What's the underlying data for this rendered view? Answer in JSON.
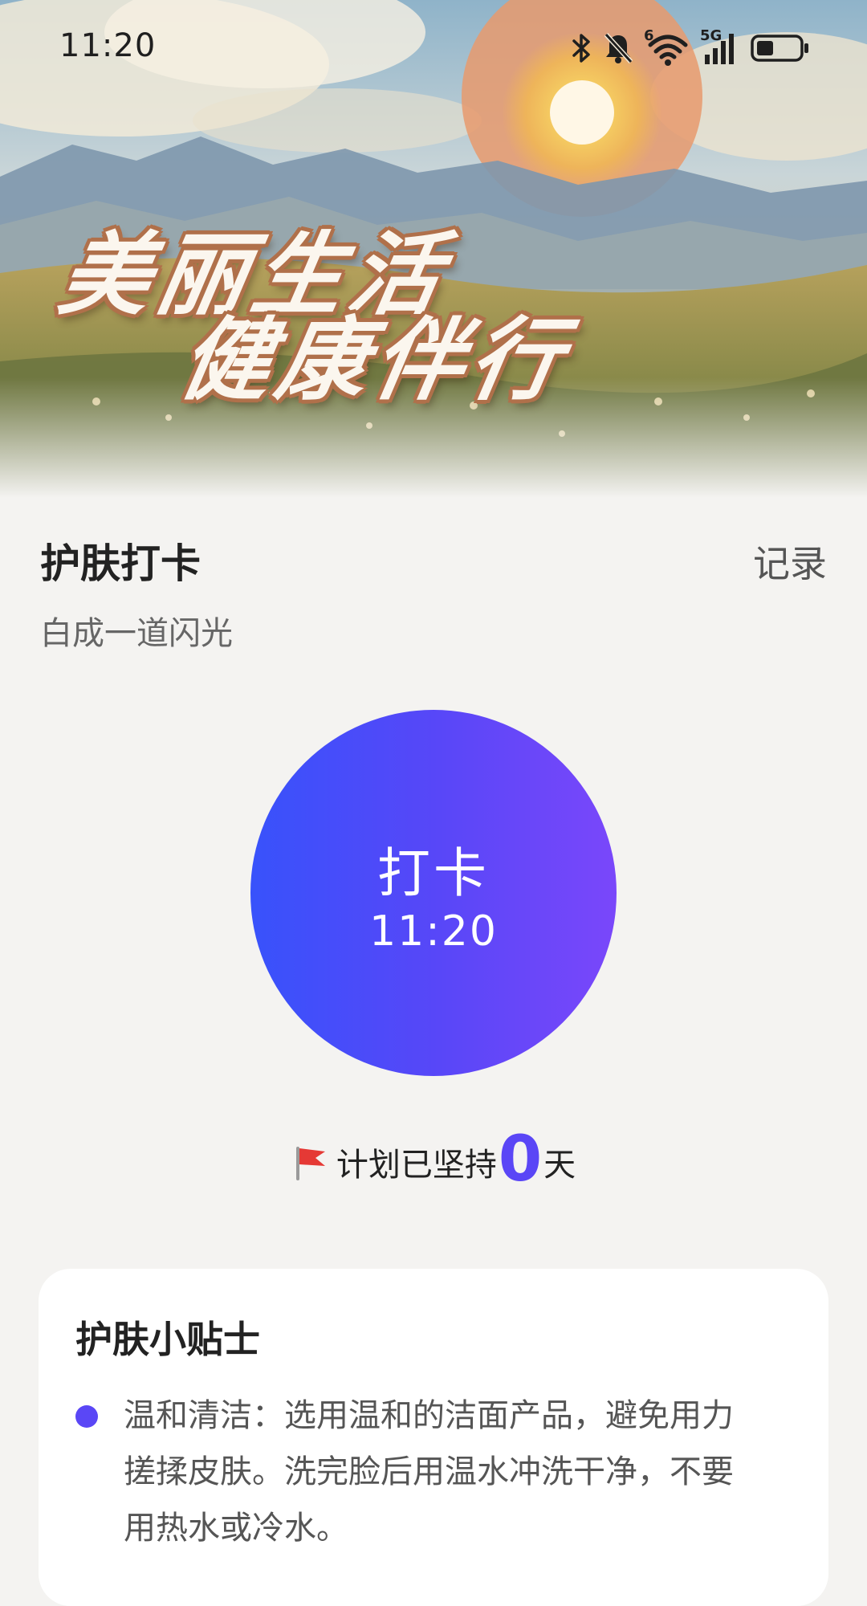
{
  "status_bar": {
    "time": "11:20",
    "icons": [
      "bluetooth-icon",
      "bell-off-icon",
      "wifi-icon",
      "5g-signal-icon",
      "battery-icon"
    ],
    "network_label": "5G",
    "wifi_label": "6"
  },
  "hero": {
    "title_line1": "美丽生活",
    "title_line2": "健康伴行"
  },
  "header": {
    "title": "护肤打卡",
    "record_label": "记录",
    "subtitle": "白成一道闪光"
  },
  "checkin": {
    "label": "打卡",
    "time": "11:20"
  },
  "streak": {
    "icon": "red-flag-icon",
    "prefix": "计划已坚持",
    "count": "0",
    "unit": "天"
  },
  "tips": {
    "title": "护肤小贴士",
    "items": [
      {
        "text": "温和清洁：选用温和的洁面产品，避免用力搓揉皮肤。洗完脸后用温水冲洗干净，不要用热水或冷水。"
      }
    ]
  },
  "colors": {
    "accent": "#5a46f6",
    "button_gradient_start": "#3852fb",
    "button_gradient_end": "#7a47fa",
    "background": "#f4f3f1"
  }
}
